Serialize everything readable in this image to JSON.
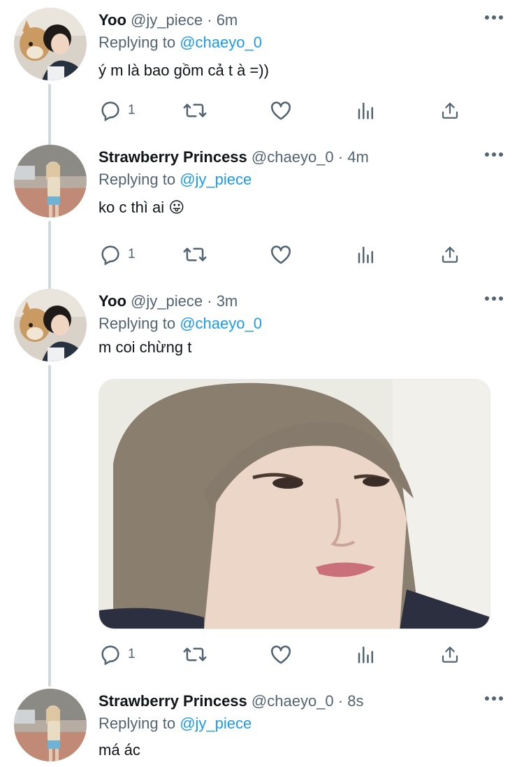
{
  "tweets": [
    {
      "name": "Yoo",
      "handle": "@jy_piece",
      "time": "6m",
      "replying_prefix": "Replying to",
      "replying_to": "@chaeyo_0",
      "text": "ý m là bao gồm cả t à =))",
      "reply_count": "1"
    },
    {
      "name": "Strawberry Princess",
      "handle": "@chaeyo_0",
      "time": "4m",
      "replying_prefix": "Replying to",
      "replying_to": "@jy_piece",
      "text": "ko c thì ai 😛",
      "reply_count": "1"
    },
    {
      "name": "Yoo",
      "handle": "@jy_piece",
      "time": "3m",
      "replying_prefix": "Replying to",
      "replying_to": "@chaeyo_0",
      "text": "m coi chừng t",
      "reply_count": "1"
    },
    {
      "name": "Strawberry Princess",
      "handle": "@chaeyo_0",
      "time": "8s",
      "replying_prefix": "Replying to",
      "replying_to": "@jy_piece",
      "text": "má ác"
    }
  ],
  "separator": "·",
  "icons": {
    "reply": "reply-icon",
    "retweet": "retweet-icon",
    "like": "heart-icon",
    "analytics": "analytics-icon",
    "share": "share-icon",
    "more": "more-dots-icon"
  },
  "colors": {
    "text": "#0f1419",
    "secondary": "#536471",
    "link": "#1d9bf0"
  }
}
